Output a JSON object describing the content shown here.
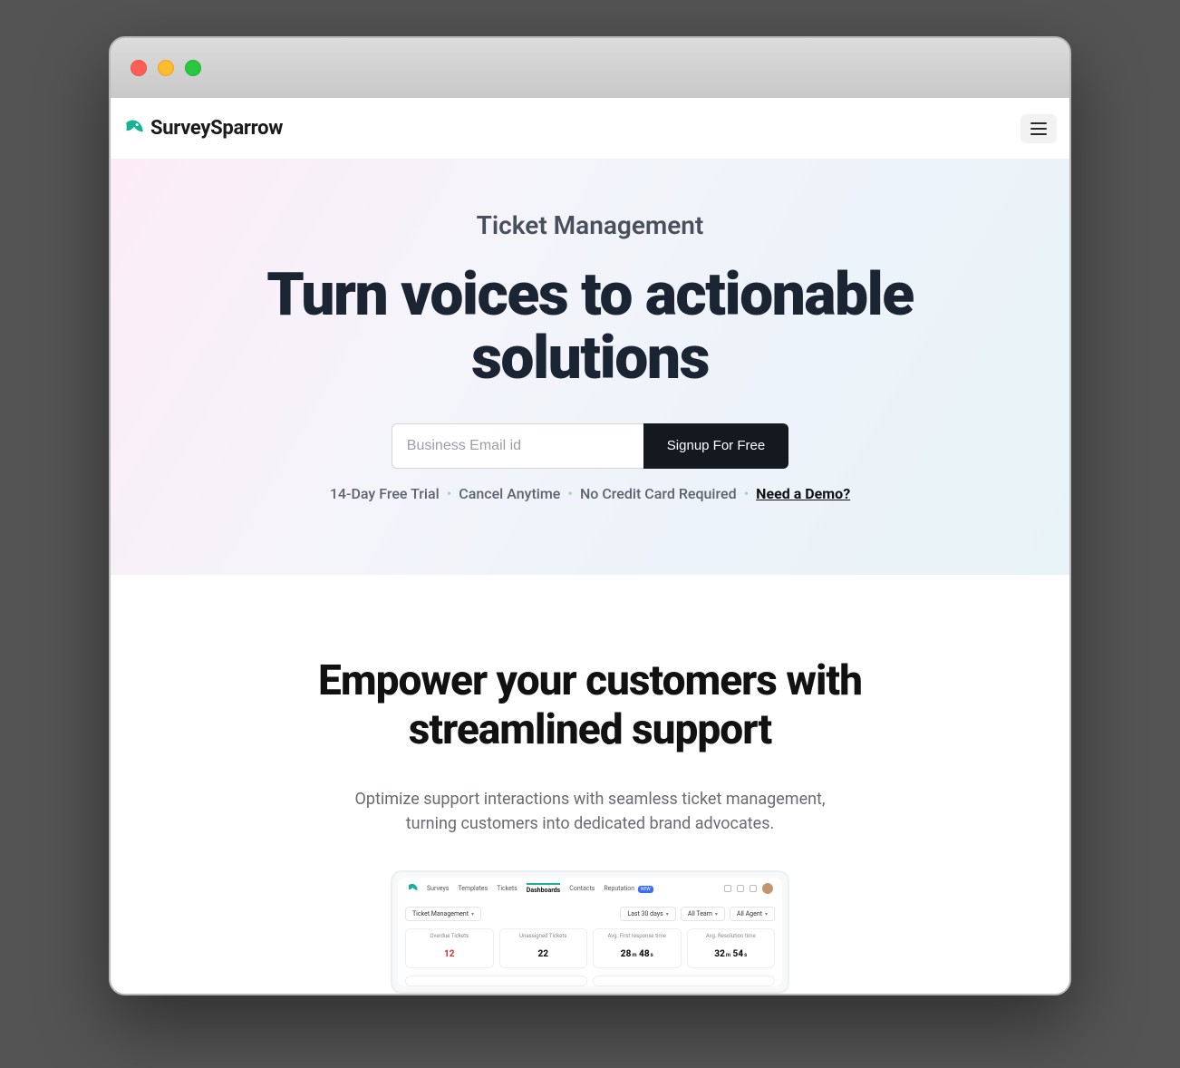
{
  "brand": {
    "name": "SurveySparrow"
  },
  "hero": {
    "eyebrow": "Ticket Management",
    "headline": "Turn voices to actionable solutions",
    "email_placeholder": "Business Email id",
    "cta_label": "Signup For Free",
    "sub": {
      "trial": "14-Day Free Trial",
      "cancel": "Cancel Anytime",
      "nocc": "No Credit Card Required",
      "demo_label": "Need a Demo?"
    }
  },
  "section2": {
    "heading": "Empower your customers with streamlined support",
    "lead": "Optimize support interactions with seamless ticket management, turning customers into dedicated brand advocates."
  },
  "dashboard": {
    "tabs": [
      "Surveys",
      "Templates",
      "Tickets",
      "Dashboards",
      "Contacts",
      "Reputation"
    ],
    "active_tab": "Dashboards",
    "new_badge": "NEW",
    "title_chip": "Ticket Management",
    "filters": [
      "Last 30 days",
      "All Team",
      "All Agent"
    ],
    "stats": [
      {
        "label": "Overdue Tickets",
        "value_html": "12",
        "red": true
      },
      {
        "label": "Unassigned Tickets",
        "value_html": "22"
      },
      {
        "label": "Avg. First response time",
        "value_html": "28m 48s",
        "time": true
      },
      {
        "label": "Avg. Resolution time",
        "value_html": "32m 54s",
        "time": true
      }
    ]
  }
}
